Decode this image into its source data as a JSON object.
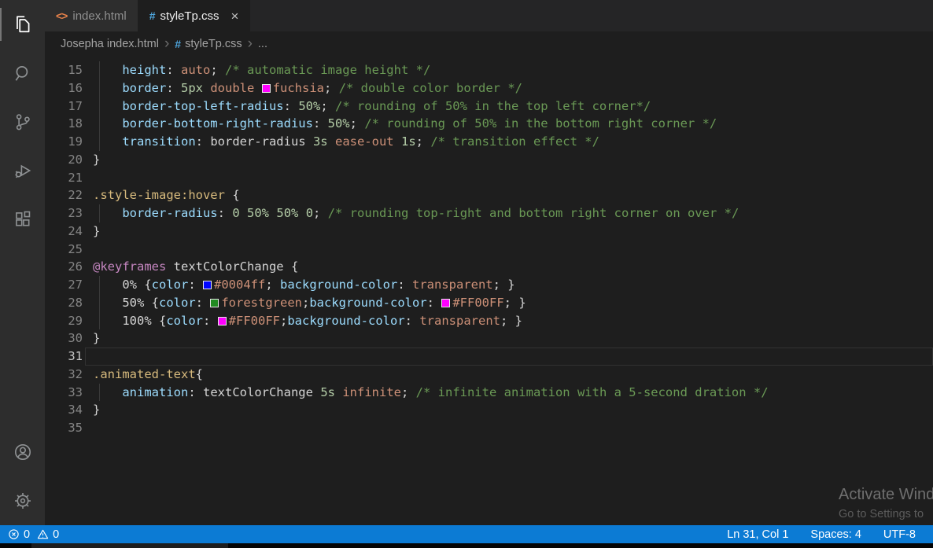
{
  "activity_bar": {
    "items": [
      {
        "name": "explorer",
        "icon": "files-icon",
        "active": true
      },
      {
        "name": "search",
        "icon": "search-icon",
        "active": false
      },
      {
        "name": "source-control",
        "icon": "git-branch-icon",
        "active": false
      },
      {
        "name": "run-debug",
        "icon": "debug-play-bug-icon",
        "active": false
      },
      {
        "name": "extensions",
        "icon": "extensions-icon",
        "active": false
      }
    ],
    "bottom_items": [
      {
        "name": "account",
        "icon": "account-icon"
      },
      {
        "name": "settings",
        "icon": "gear-icon"
      }
    ]
  },
  "tabs": {
    "items": [
      {
        "label": "index.html",
        "icon": "html-code-icon",
        "icon_glyph": "<>",
        "icon_color": "#e8824a",
        "active": false,
        "close_label": ""
      },
      {
        "label": "styleTp.css",
        "icon": "css-hash-icon",
        "icon_glyph": "#",
        "icon_color": "#4fa8e0",
        "active": true,
        "close_label": "×"
      }
    ]
  },
  "breadcrumb": {
    "separator": "›",
    "items": [
      {
        "label": "Josepha index.html"
      },
      {
        "label": "styleTp.css",
        "icon_glyph": "#",
        "icon_color": "#4fa8e0"
      },
      {
        "label": "..."
      }
    ]
  },
  "editor": {
    "language": "css",
    "cursor_line": 31,
    "lines": [
      {
        "n": 15,
        "g": 1,
        "t": [
          [
            "w",
            "    "
          ],
          [
            "p",
            "height"
          ],
          [
            "w",
            ": "
          ],
          [
            "v",
            "auto"
          ],
          [
            "w",
            "; "
          ],
          [
            "c",
            "/* automatic image height */"
          ]
        ]
      },
      {
        "n": 16,
        "g": 1,
        "t": [
          [
            "w",
            "    "
          ],
          [
            "p",
            "border"
          ],
          [
            "w",
            ": "
          ],
          [
            "n",
            "5px"
          ],
          [
            "w",
            " "
          ],
          [
            "v",
            "double"
          ],
          [
            "w",
            " "
          ],
          [
            "sw",
            "#FF00FF"
          ],
          [
            "v",
            "fuchsia"
          ],
          [
            "w",
            "; "
          ],
          [
            "c",
            "/* double color border */"
          ]
        ]
      },
      {
        "n": 17,
        "g": 1,
        "t": [
          [
            "w",
            "    "
          ],
          [
            "p",
            "border-top-left-radius"
          ],
          [
            "w",
            ": "
          ],
          [
            "n",
            "50%"
          ],
          [
            "w",
            "; "
          ],
          [
            "c",
            "/* rounding of 50% in the top left corner*/"
          ]
        ]
      },
      {
        "n": 18,
        "g": 1,
        "t": [
          [
            "w",
            "    "
          ],
          [
            "p",
            "border-bottom-right-radius"
          ],
          [
            "w",
            ": "
          ],
          [
            "n",
            "50%"
          ],
          [
            "w",
            "; "
          ],
          [
            "c",
            "/* rounding of 50% in the bottom right corner */"
          ]
        ]
      },
      {
        "n": 19,
        "g": 1,
        "t": [
          [
            "w",
            "    "
          ],
          [
            "p",
            "transition"
          ],
          [
            "w",
            ": border-radius "
          ],
          [
            "n",
            "3s"
          ],
          [
            "w",
            " "
          ],
          [
            "v",
            "ease-out"
          ],
          [
            "w",
            " "
          ],
          [
            "n",
            "1s"
          ],
          [
            "w",
            "; "
          ],
          [
            "c",
            "/* transition effect */"
          ]
        ]
      },
      {
        "n": 20,
        "t": [
          [
            "w",
            "}"
          ]
        ]
      },
      {
        "n": 21,
        "t": []
      },
      {
        "n": 22,
        "t": [
          [
            "s",
            ".style-image:hover"
          ],
          [
            "w",
            " {"
          ]
        ]
      },
      {
        "n": 23,
        "g": 1,
        "t": [
          [
            "w",
            "    "
          ],
          [
            "p",
            "border-radius"
          ],
          [
            "w",
            ": "
          ],
          [
            "n",
            "0"
          ],
          [
            "w",
            " "
          ],
          [
            "n",
            "50%"
          ],
          [
            "w",
            " "
          ],
          [
            "n",
            "50%"
          ],
          [
            "w",
            " "
          ],
          [
            "n",
            "0"
          ],
          [
            "w",
            "; "
          ],
          [
            "c",
            "/* rounding top-right and bottom right corner on over */"
          ]
        ]
      },
      {
        "n": 24,
        "t": [
          [
            "w",
            "}"
          ]
        ]
      },
      {
        "n": 25,
        "t": []
      },
      {
        "n": 26,
        "t": [
          [
            "a",
            "@keyframes"
          ],
          [
            "w",
            " textColorChange {"
          ]
        ]
      },
      {
        "n": 27,
        "g": 1,
        "t": [
          [
            "w",
            "    0% {"
          ],
          [
            "p",
            "color"
          ],
          [
            "w",
            ": "
          ],
          [
            "sw",
            "#0004ff"
          ],
          [
            "v",
            "#0004ff"
          ],
          [
            "w",
            "; "
          ],
          [
            "p",
            "background-color"
          ],
          [
            "w",
            ": "
          ],
          [
            "v",
            "transparent"
          ],
          [
            "w",
            "; }"
          ]
        ]
      },
      {
        "n": 28,
        "g": 1,
        "t": [
          [
            "w",
            "    50% {"
          ],
          [
            "p",
            "color"
          ],
          [
            "w",
            ": "
          ],
          [
            "sw",
            "#228B22"
          ],
          [
            "v",
            "forestgreen"
          ],
          [
            "w",
            ";"
          ],
          [
            "p",
            "background-color"
          ],
          [
            "w",
            ": "
          ],
          [
            "sw",
            "#FF00FF"
          ],
          [
            "v",
            "#FF00FF"
          ],
          [
            "w",
            "; }"
          ]
        ]
      },
      {
        "n": 29,
        "g": 1,
        "t": [
          [
            "w",
            "    100% {"
          ],
          [
            "p",
            "color"
          ],
          [
            "w",
            ": "
          ],
          [
            "sw",
            "#FF00FF"
          ],
          [
            "v",
            "#FF00FF"
          ],
          [
            "w",
            ";"
          ],
          [
            "p",
            "background-color"
          ],
          [
            "w",
            ": "
          ],
          [
            "v",
            "transparent"
          ],
          [
            "w",
            "; }"
          ]
        ]
      },
      {
        "n": 30,
        "t": [
          [
            "w",
            "}"
          ]
        ]
      },
      {
        "n": 31,
        "cur": 1,
        "t": []
      },
      {
        "n": 32,
        "t": [
          [
            "s",
            ".animated-text"
          ],
          [
            "w",
            "{"
          ]
        ]
      },
      {
        "n": 33,
        "g": 1,
        "t": [
          [
            "w",
            "    "
          ],
          [
            "p",
            "animation"
          ],
          [
            "w",
            ": textColorChange "
          ],
          [
            "n",
            "5s"
          ],
          [
            "w",
            " "
          ],
          [
            "v",
            "infinite"
          ],
          [
            "w",
            "; "
          ],
          [
            "c",
            "/* infinite animation with a 5-second dration */"
          ]
        ]
      },
      {
        "n": 34,
        "t": [
          [
            "w",
            "}"
          ]
        ]
      },
      {
        "n": 35,
        "t": []
      }
    ]
  },
  "watermark": {
    "line1": "Activate Wind",
    "line2": "Go to Settings to"
  },
  "status_bar": {
    "errors": "0",
    "warnings": "0",
    "right_items": [
      "Ln 31, Col 1",
      "Spaces: 4",
      "UTF-8"
    ]
  },
  "colors": {
    "status_bar_bg": "#0c7bd4",
    "editor_bg": "#1e1e1e",
    "activity_bar_bg": "#2d2d2d",
    "tab_strip_bg": "#252526",
    "css_icon_blue": "#4fa8e0",
    "html_icon_orange": "#e8824a",
    "comment_green": "#6a9955",
    "property_blue": "#9cdcfe",
    "value_salmon": "#ce9178",
    "number_green": "#b5cea8",
    "selector_gold": "#d7ba7d",
    "atrule_pink": "#c586c0"
  }
}
